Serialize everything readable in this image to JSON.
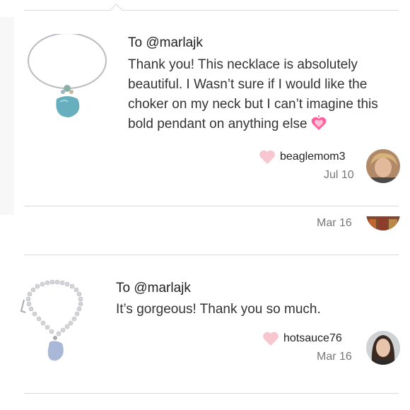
{
  "reviews": [
    {
      "to": "To @marlajk",
      "message": "Thank you! This necklace is absolutely beautiful. I Wasn’t sure if I would like the choker on my neck but I can’t imagine this bold pendant on anything else",
      "emoji": "growing-heart-icon",
      "username": "beaglemom3",
      "date": "Jul 10"
    },
    {
      "date": "Mar 16"
    },
    {
      "to": "To @marlajk",
      "message": "It’s gorgeous! Thank you so much.",
      "username": "hotsauce76",
      "date": "Mar 16"
    }
  ],
  "colors": {
    "heart": "#f8c6cf",
    "emoji": "#ff5f9e",
    "divider": "#d9d9d9"
  }
}
